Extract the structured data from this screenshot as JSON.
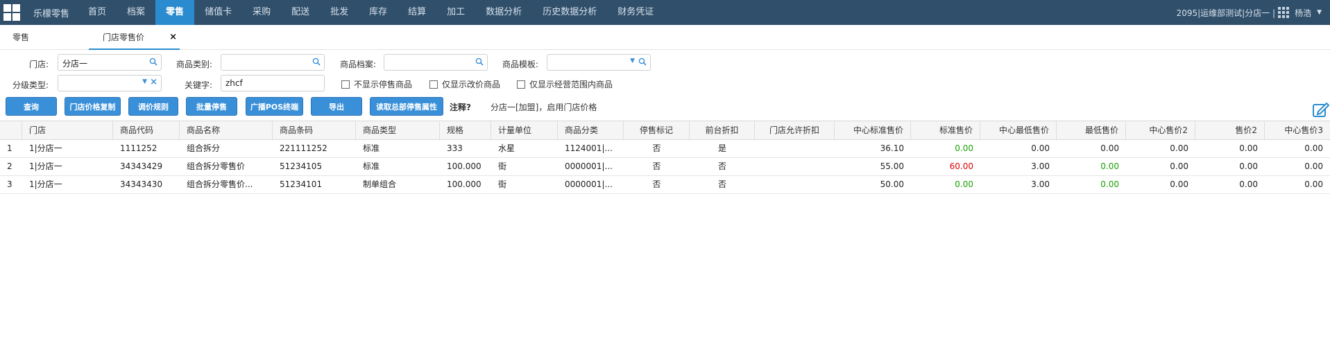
{
  "nav": {
    "brand": "乐檬零售",
    "items": [
      "首页",
      "档案",
      "零售",
      "储值卡",
      "采购",
      "配送",
      "批发",
      "库存",
      "结算",
      "加工",
      "数据分析",
      "历史数据分析",
      "财务凭证"
    ],
    "user_info": "2095|运维部测试|分店一 |",
    "user_name": "杨浩"
  },
  "tabs": {
    "retail": "零售",
    "store_price": "门店零售价",
    "close": "×"
  },
  "filters": {
    "store_label": "门店:",
    "store_value": "分店一",
    "category_label": "商品类别:",
    "category_value": "",
    "archive_label": "商品档案:",
    "archive_value": "",
    "template_label": "商品模板:",
    "template_value": "",
    "level_label": "分级类型:",
    "level_value": "",
    "keyword_label": "关键字:",
    "keyword_value": "zhcf",
    "chk_hide_stopped": "不显示停售商品",
    "chk_only_changed": "仅显示改价商品",
    "chk_only_range": "仅显示经营范围内商品"
  },
  "buttons": {
    "query": "查询",
    "copy": "门店价格复制",
    "rule": "调价规则",
    "batch_stop": "批量停售",
    "broadcast": "广播POS终端",
    "export": "导出",
    "fetch": "读取总部停售属性"
  },
  "note": {
    "label": "注释?",
    "text": "分店一[加盟]，启用门店价格"
  },
  "table": {
    "headers": [
      "门店",
      "商品代码",
      "商品名称",
      "商品条码",
      "商品类型",
      "规格",
      "计量单位",
      "商品分类",
      "停售标记",
      "前台折扣",
      "门店允许折扣",
      "中心标准售价",
      "标准售价",
      "中心最低售价",
      "最低售价",
      "中心售价2",
      "售价2",
      "中心售价3"
    ],
    "rows": [
      [
        "1",
        "1|分店一",
        "1111252",
        "组合拆分",
        "221111252",
        "标准",
        "333",
        "水星",
        "1124001|...",
        "否",
        "是",
        "",
        "36.10",
        "0.00",
        "0.00",
        "0.00",
        "0.00",
        "0.00",
        "0.00"
      ],
      [
        "2",
        "1|分店一",
        "34343429",
        "组合拆分零售价",
        "51234105",
        "标准",
        "100.000",
        "街",
        "0000001|...",
        "否",
        "否",
        "",
        "55.00",
        "60.00",
        "3.00",
        "0.00",
        "0.00",
        "0.00",
        "0.00"
      ],
      [
        "3",
        "1|分店一",
        "34343430",
        "组合拆分零售价...",
        "51234101",
        "制单组合",
        "100.000",
        "街",
        "0000001|...",
        "否",
        "否",
        "",
        "50.00",
        "0.00",
        "3.00",
        "0.00",
        "0.00",
        "0.00",
        "0.00"
      ]
    ],
    "std_price_colors": [
      "#19a000",
      "#e00000",
      "#19a000"
    ],
    "min_price_colors": [
      "#333333",
      "#19a000",
      "#19a000"
    ]
  },
  "colors": {
    "nav_bg": "#2f4f6b",
    "accent": "#2a8ccf",
    "button": "#3a90d8"
  }
}
